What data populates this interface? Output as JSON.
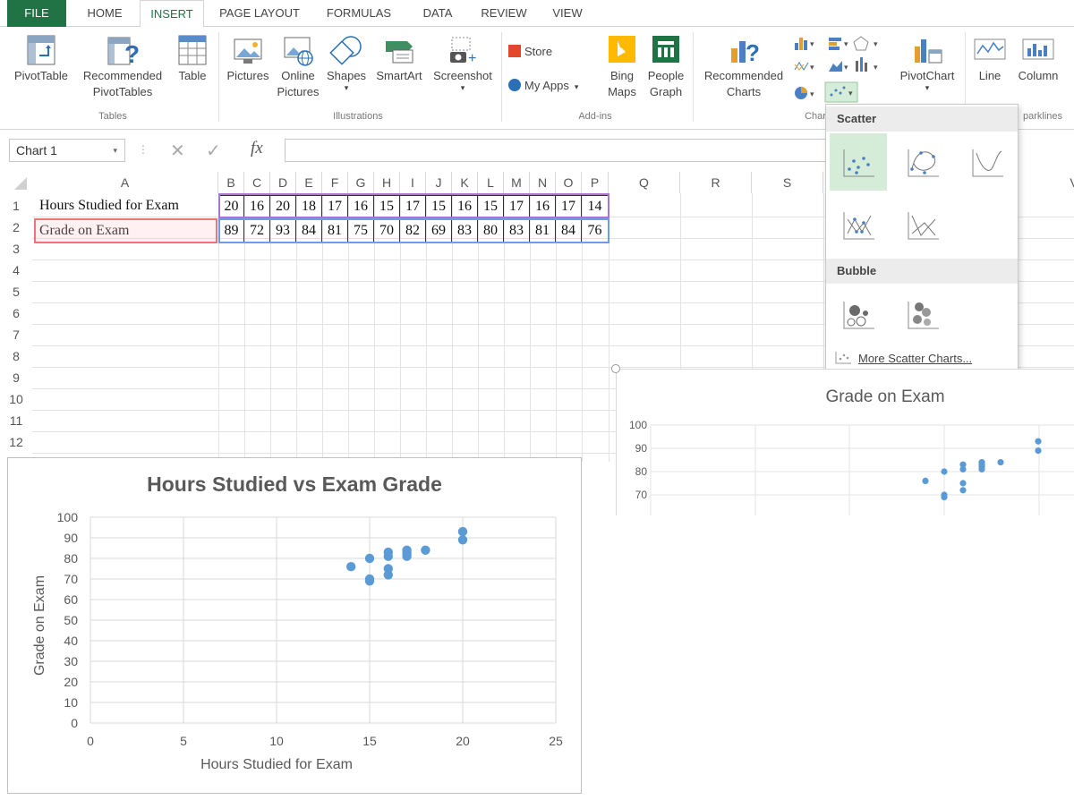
{
  "ribbon_tabs": [
    "FILE",
    "HOME",
    "INSERT",
    "PAGE LAYOUT",
    "FORMULAS",
    "DATA",
    "REVIEW",
    "VIEW"
  ],
  "ribbon": {
    "pivot_table": "PivotTable",
    "recommended_pivot_1": "Recommended",
    "recommended_pivot_2": "PivotTables",
    "table": "Table",
    "group_tables": "Tables",
    "pictures": "Pictures",
    "online_pictures_1": "Online",
    "online_pictures_2": "Pictures",
    "shapes": "Shapes",
    "smartart": "SmartArt",
    "screenshot": "Screenshot",
    "group_illustrations": "Illustrations",
    "store": "Store",
    "my_apps": "My Apps",
    "bing_maps_1": "Bing",
    "bing_maps_2": "Maps",
    "people_graph_1": "People",
    "people_graph_2": "Graph",
    "group_addins": "Add-ins",
    "recommended_charts_1": "Recommended",
    "recommended_charts_2": "Charts",
    "pivot_chart": "PivotChart",
    "group_charts": "Char",
    "line": "Line",
    "column": "Column",
    "group_sparklines": "parklines"
  },
  "formula_bar": {
    "name_box": "Chart 1",
    "fx": "fx"
  },
  "columns": [
    "A",
    "B",
    "C",
    "D",
    "E",
    "F",
    "G",
    "H",
    "I",
    "J",
    "K",
    "L",
    "M",
    "N",
    "O",
    "P",
    "Q",
    "R",
    "S",
    "V"
  ],
  "rows": [
    "1",
    "2",
    "3",
    "4",
    "5",
    "6",
    "7",
    "8",
    "9",
    "10",
    "11",
    "12"
  ],
  "sheet": {
    "row1_label": "Hours Studied for Exam",
    "row2_label": "Grade on Exam",
    "hours": [
      "20",
      "16",
      "20",
      "18",
      "17",
      "16",
      "15",
      "17",
      "15",
      "16",
      "15",
      "17",
      "16",
      "17",
      "14"
    ],
    "grades": [
      "89",
      "72",
      "93",
      "84",
      "81",
      "75",
      "70",
      "82",
      "69",
      "83",
      "80",
      "83",
      "81",
      "84",
      "76"
    ]
  },
  "dropdown": {
    "scatter_header": "Scatter",
    "bubble_header": "Bubble",
    "more_link": "More Scatter Charts..."
  },
  "chart_data": [
    {
      "type": "scatter",
      "title": "Hours Studied vs Exam Grade",
      "xlabel": "Hours Studied for Exam",
      "ylabel": "Grade on Exam",
      "xlim": [
        0,
        25
      ],
      "ylim": [
        0,
        100
      ],
      "xticks": [
        0,
        5,
        10,
        15,
        20,
        25
      ],
      "yticks": [
        0,
        10,
        20,
        30,
        40,
        50,
        60,
        70,
        80,
        90,
        100
      ],
      "grid": true,
      "color": "#5b9bd5",
      "x": [
        20,
        16,
        20,
        18,
        17,
        16,
        15,
        17,
        15,
        16,
        15,
        17,
        16,
        17,
        14
      ],
      "y": [
        89,
        72,
        93,
        84,
        81,
        75,
        70,
        82,
        69,
        83,
        80,
        83,
        81,
        84,
        76
      ]
    },
    {
      "type": "scatter",
      "title": "Grade on Exam",
      "ylim": [
        70,
        100
      ],
      "yticks": [
        70,
        80,
        90,
        100
      ],
      "grid": true,
      "color": "#5b9bd5",
      "x": [
        20,
        16,
        20,
        18,
        17,
        16,
        15,
        17,
        15,
        16,
        15,
        17,
        16,
        17,
        14
      ],
      "y": [
        89,
        72,
        93,
        84,
        81,
        75,
        70,
        82,
        69,
        83,
        80,
        83,
        81,
        84,
        76
      ]
    }
  ],
  "colors": {
    "excel_green": "#217346",
    "marker_blue": "#5b9bd5",
    "selected_highlight": "#d5ecd8"
  }
}
